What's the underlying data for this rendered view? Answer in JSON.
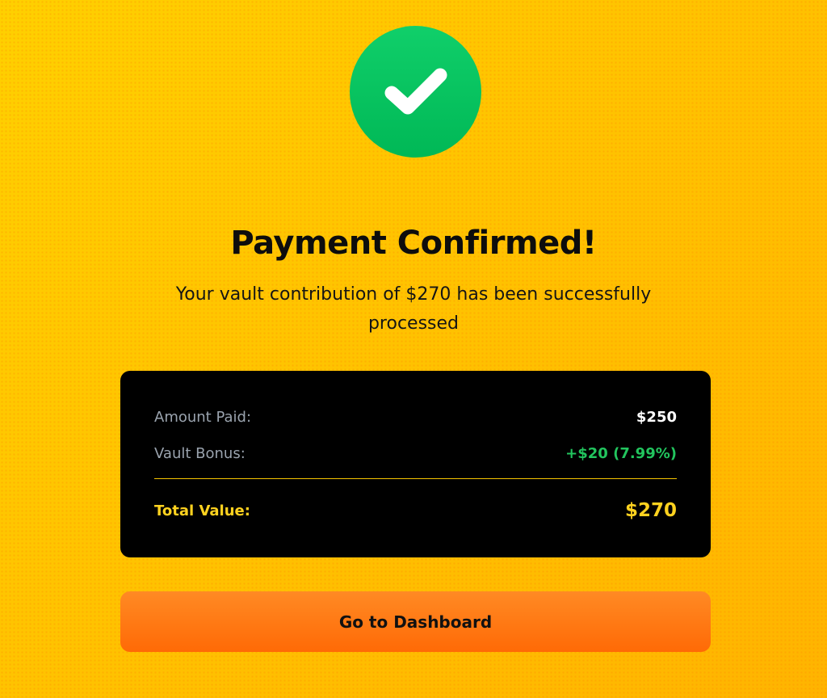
{
  "confirmation": {
    "icon": "checkmark-icon",
    "title": "Payment Confirmed!",
    "message": "Your vault contribution of $270 has been successfully processed"
  },
  "summary": {
    "amount_paid_label": "Amount Paid:",
    "amount_paid_value": "$250",
    "vault_bonus_label": "Vault Bonus:",
    "vault_bonus_value": "+$20 (7.99%)",
    "total_value_label": "Total Value:",
    "total_value_value": "$270"
  },
  "actions": {
    "dashboard_label": "Go to Dashboard"
  },
  "colors": {
    "background": "#ffc400",
    "success": "#00c060",
    "card": "#000000",
    "accent_yellow": "#ffd21f",
    "bonus_green": "#22c55e",
    "button_orange": "#ff7a12"
  }
}
